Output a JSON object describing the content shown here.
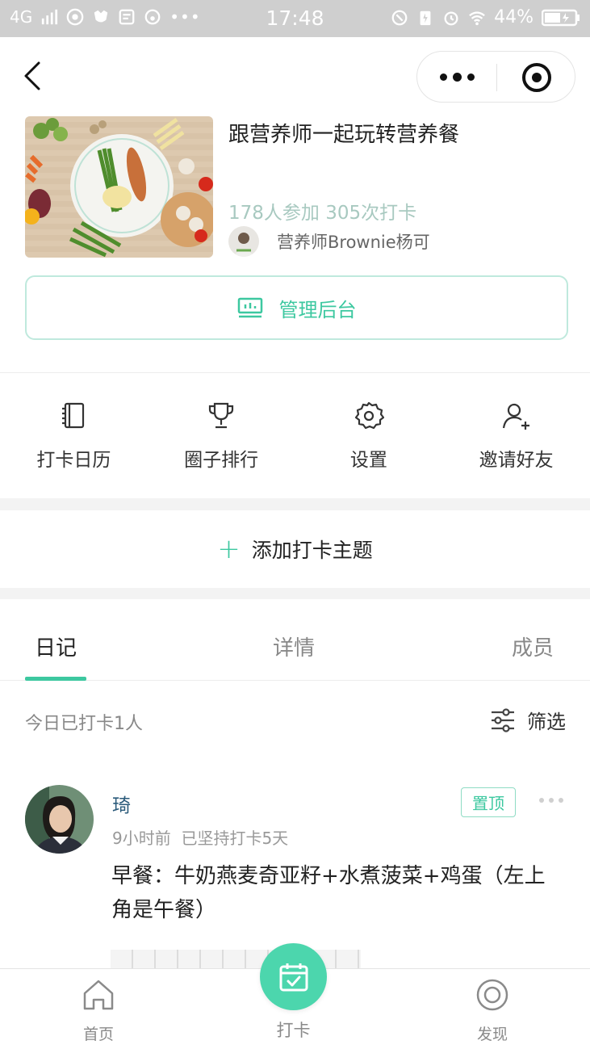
{
  "status_bar": {
    "network": "4G",
    "time": "17:48",
    "battery": "44%"
  },
  "header": {
    "title": "跟营养师一起玩转营养餐",
    "stats": "178人参加 305次打卡",
    "author_name": "营养师Brownie杨可",
    "admin_button_label": "管理后台"
  },
  "actions": [
    {
      "label": "打卡日历",
      "icon": "calendar-book-icon"
    },
    {
      "label": "圈子排行",
      "icon": "trophy-icon"
    },
    {
      "label": "设置",
      "icon": "gear-icon"
    },
    {
      "label": "邀请好友",
      "icon": "add-user-icon"
    }
  ],
  "add_topic_label": "添加打卡主题",
  "tabs": [
    {
      "label": "日记",
      "active": true
    },
    {
      "label": "详情",
      "active": false
    },
    {
      "label": "成员",
      "active": false
    }
  ],
  "feed": {
    "today_count": "今日已打卡1人",
    "filter_label": "筛选"
  },
  "post": {
    "user": "琦",
    "badge": "置顶",
    "meta": "9小时前  已坚持打卡5天",
    "text": "早餐：牛奶燕麦奇亚籽+水煮菠菜+鸡蛋（左上角是午餐）"
  },
  "tabbar": {
    "home_label": "首页",
    "checkin_label": "打卡",
    "discover_label": "发现"
  },
  "colors": {
    "accent": "#3dc8a0",
    "accent_light": "#bfe9dd",
    "username": "#2a5a7a"
  }
}
